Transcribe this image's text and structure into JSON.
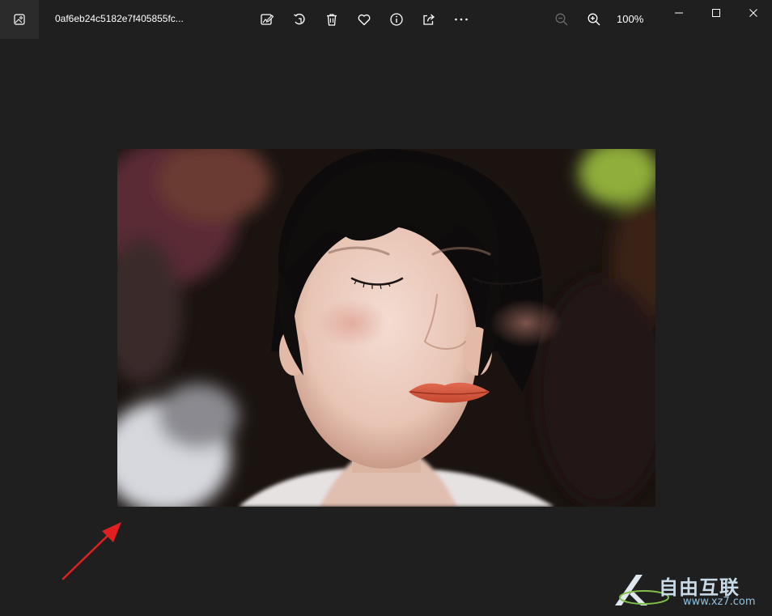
{
  "titlebar": {
    "filename": "0af6eb24c5182e7f405855fc...",
    "zoom_level": "100%"
  },
  "toolbar": {
    "icons": [
      "edit-image-icon",
      "rotate-icon",
      "delete-icon",
      "favorite-icon",
      "info-icon",
      "share-icon",
      "more-icon"
    ]
  },
  "zoom": {
    "icons": [
      "zoom-out-icon",
      "zoom-in-icon"
    ]
  },
  "window_controls": [
    "minimize-icon",
    "maximize-icon",
    "close-icon"
  ],
  "colors": {
    "background": "#1f1f1f",
    "titlebar_icon_bg": "#2b2b2b",
    "annotation_arrow": "#e02020"
  },
  "watermark": {
    "brand": "自由互联",
    "url": "www.xz7.com"
  }
}
